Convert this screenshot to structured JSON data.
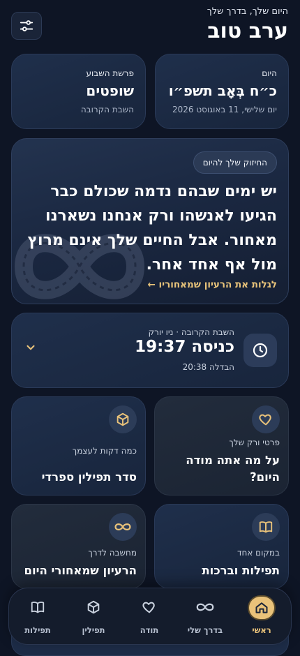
{
  "header": {
    "subtitle": "היום שלך, בדרך שלך",
    "greeting": "ערב טוב"
  },
  "today_card": {
    "label": "היום",
    "hebrew_date": "כ״ח בְּאָב תשפ״ו",
    "gregorian_date": "יום שלישי, 11 באוגוסט 2026"
  },
  "parasha_card": {
    "label": "פרשת השבוע",
    "name": "שופטים",
    "sub": "השבת הקרובה"
  },
  "inspiration": {
    "badge": "החיזוק שלך להיום",
    "quote": "יש ימים שבהם נדמה שכולם כבר הגיעו לאנשהו ורק אנחנו נשארנו מאחור. אבל החיים שלך אינם מרוץ מול אף אחד אחר.",
    "link": "לגלות את הרעיון שמאחוריו ←"
  },
  "shabbat": {
    "label": "השבת הקרובה · ניו יורק",
    "entry": "כניסה 19:37",
    "havdalah": "הבדלה 20:38"
  },
  "features": [
    {
      "label": "פרטי ורק שלך",
      "title": "על מה אתה מודה היום?",
      "icon": "heart-icon"
    },
    {
      "label": "כמה דקות לעצמך",
      "title": "סדר תפילין ספרדי",
      "icon": "box-icon"
    },
    {
      "label": "במקום אחד",
      "title": "תפילות וברכות",
      "icon": "book-icon"
    },
    {
      "label": "מחשבה לדרך",
      "title": "הרעיון שמאחורי היום",
      "icon": "infinity-icon"
    }
  ],
  "nav": [
    {
      "label": "ראשי",
      "icon": "home-icon",
      "active": true
    },
    {
      "label": "בדרך שלי",
      "icon": "infinity-icon",
      "active": false
    },
    {
      "label": "תודה",
      "icon": "heart-icon",
      "active": false
    },
    {
      "label": "תפילין",
      "icon": "box-icon",
      "active": false
    },
    {
      "label": "תפילות",
      "icon": "book-icon",
      "active": false
    }
  ],
  "colors": {
    "background": "#0e1525",
    "accent": "#e9c27a",
    "card": "#1f2f4b"
  }
}
